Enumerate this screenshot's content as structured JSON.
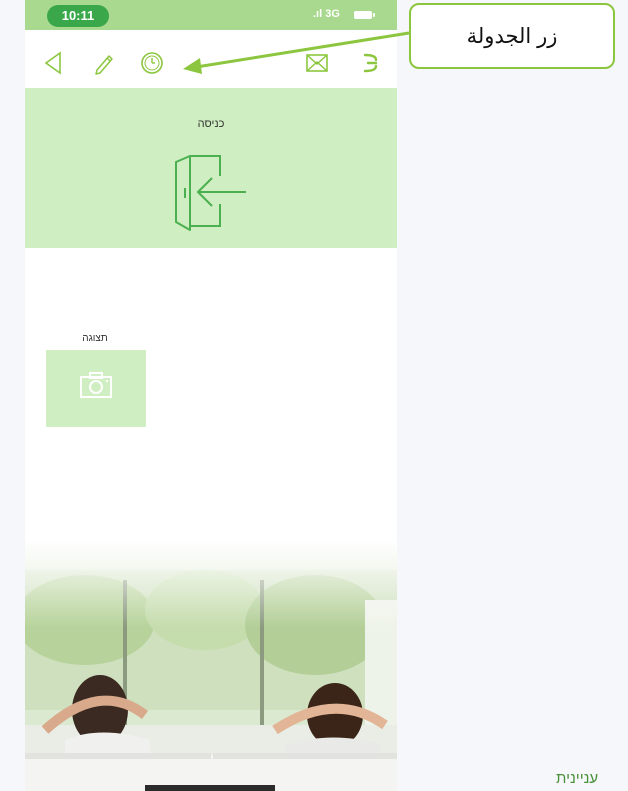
{
  "status_bar": {
    "time": "10:11",
    "network": "3G"
  },
  "toolbar": {
    "icons": [
      "back-icon",
      "edit-pencil-icon",
      "schedule-clock-icon",
      "mail-icon",
      "menu-icon"
    ]
  },
  "entrance": {
    "label": "כניסה",
    "icon": "door-enter-icon"
  },
  "display": {
    "label": "תצוגה",
    "icon": "camera-icon"
  },
  "callout": {
    "text": "زر الجدولة"
  },
  "footer": {
    "text": "עניינית"
  },
  "colors": {
    "accent": "#8cc63f",
    "status_bar": "#a9d98f",
    "tile_bg": "#cfeec1",
    "pill": "#3aa84a"
  }
}
